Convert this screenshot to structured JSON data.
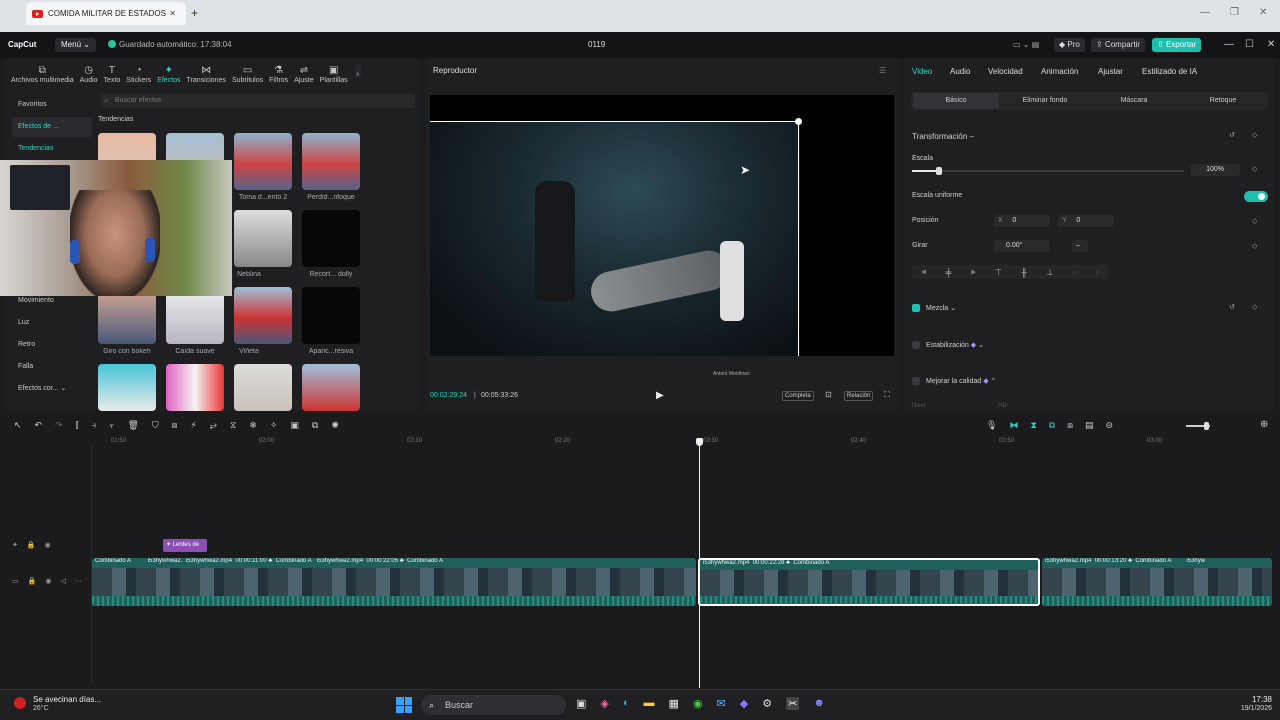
{
  "browser": {
    "tab_title": "COMIDA MILITAR DE ESTADOS",
    "new_tab": "+",
    "close": "✕"
  },
  "app": {
    "logo": "CapCut",
    "menu": "Menú",
    "autosave": "Guardado automático: 17:38:04",
    "project": "0119",
    "pro": "Pro",
    "share": "Compartir",
    "export": "Exportar"
  },
  "toolbar": {
    "items": [
      "Archivos multimedia",
      "Audio",
      "Texto",
      "Stickers",
      "Efectos",
      "Transiciones",
      "Subtítulos",
      "Filtros",
      "Ajuste",
      "Plantillas"
    ]
  },
  "effects": {
    "categories": [
      "Favoritos",
      "Efectos de ...",
      "Tendencias",
      "Movimiento",
      "Luz",
      "Retro",
      "Falla",
      "Efectos cor..."
    ],
    "search_placeholder": "Buscar efectos",
    "section": "Tendencias",
    "thumbs": [
      "",
      "",
      "Toma d...ento 2",
      "Pérdid...nfoque",
      "Neblina",
      "Recort... dolly",
      "Giro con bokeh",
      "Caída suave",
      "Viñeta",
      "Aparic...resiva"
    ]
  },
  "player": {
    "title": "Reproductor",
    "time_current": "00:02:29:24",
    "time_total": "00:05:33:26",
    "full": "Completa",
    "ratio": "Relación",
    "watermark": "Antoni Weidman"
  },
  "props": {
    "tabs": [
      "Video",
      "Audio",
      "Velocidad",
      "Animación",
      "Ajustar",
      "Estilizado de IA"
    ],
    "subtabs": [
      "Básico",
      "Eliminar fondo",
      "Máscara",
      "Retoque"
    ],
    "transform": "Transformación",
    "scale_label": "Escala",
    "scale_value": "100%",
    "scale_level": 0.1,
    "uniform": "Escala uniforme",
    "position": "Posición",
    "x_label": "X",
    "x_value": "0",
    "y_label": "Y",
    "y_value": "0",
    "rotate": "Girar",
    "rotate_value": "0.00°",
    "rotate_minus": "–",
    "blend": "Mezcla",
    "stabilize": "Estabilización",
    "enhance": "Mejorar la calidad",
    "level": "Nivel",
    "level_value": "HD"
  },
  "timeline": {
    "ruler": [
      "01:50",
      "02:00",
      "02:10",
      "02:20",
      "02:30",
      "02:40",
      "02:50",
      "03:00"
    ],
    "effect_tag": "Lentes de",
    "clips": [
      {
        "texts": [
          "Combinado A",
          "i53hywhwa2.",
          "i53hywhwa2.mp4",
          "00:00:11:00",
          "Combinado A",
          "i53hywhwa2.mp4",
          "00:00:22:05",
          "Combinado A"
        ]
      },
      {
        "texts": [
          "i53hywhwa2.mp4",
          "00:00:22:28",
          "Combinado A"
        ]
      },
      {
        "texts": [
          "i53hywhwa2.mp4",
          "00:00:13:20",
          "Combinado A",
          "i53hyw"
        ]
      }
    ]
  },
  "taskbar": {
    "weather": "Se avecinan días...",
    "temp": "26°C",
    "search": "Buscar",
    "time": "17:38",
    "date": "19/1/2026"
  },
  "colors": {
    "accent": "#33d6c0",
    "export": "#1fbfae"
  }
}
